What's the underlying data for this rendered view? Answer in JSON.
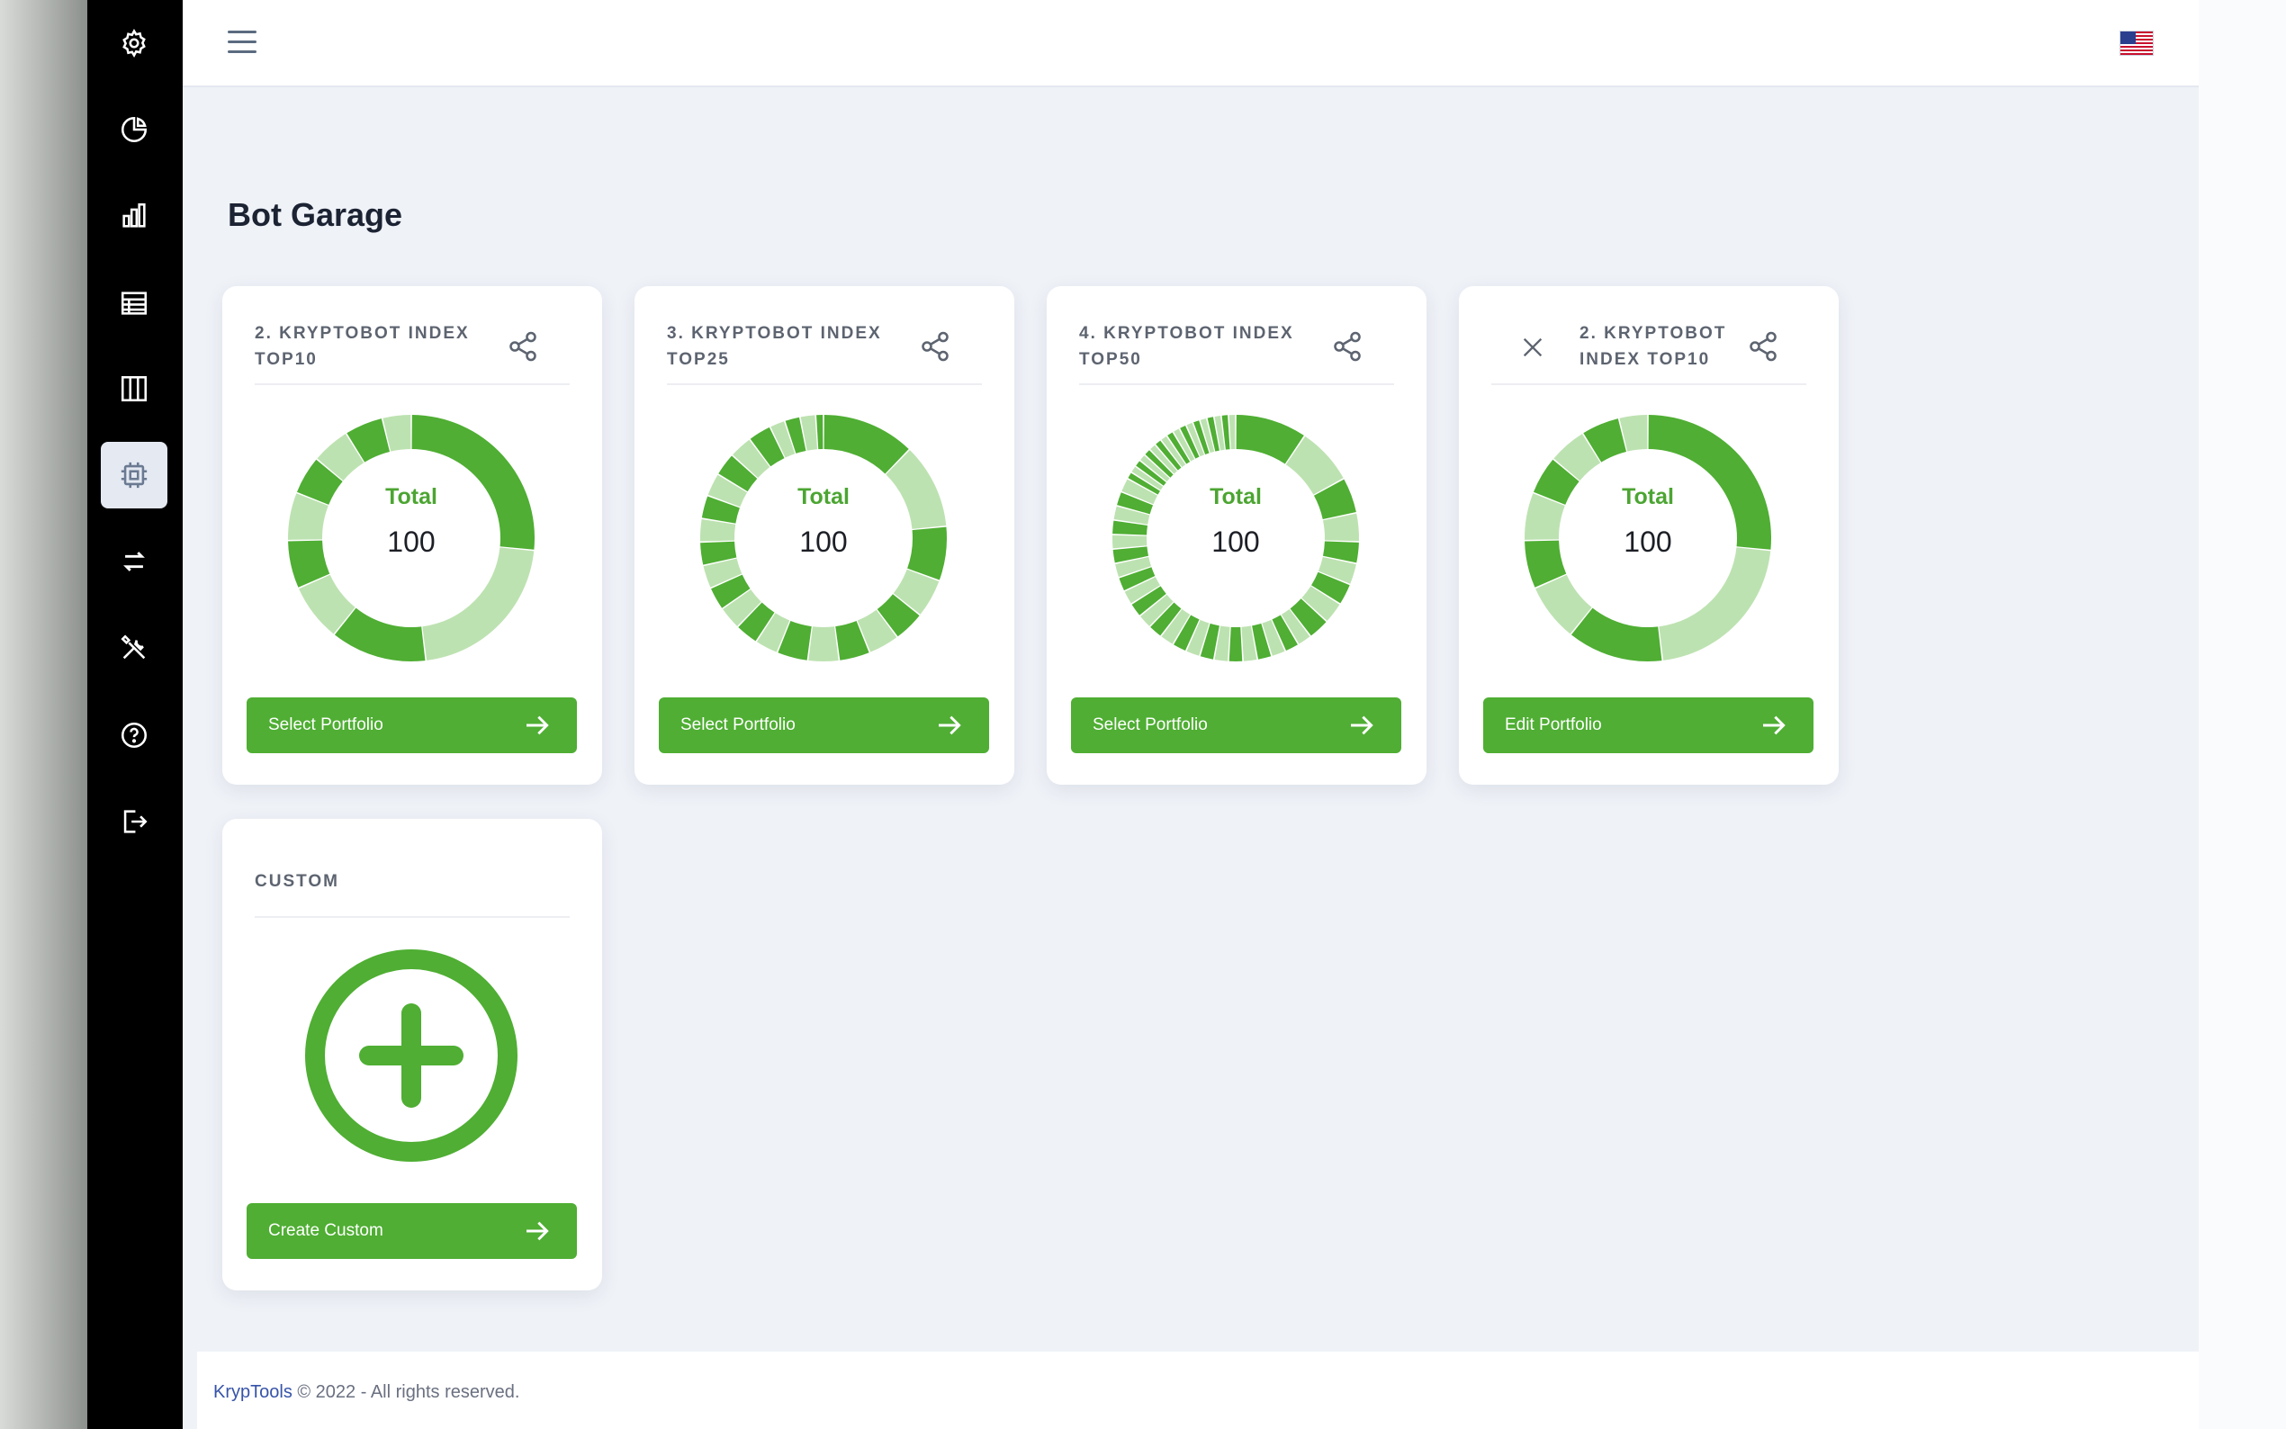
{
  "topbar": {
    "menu_icon": "hamburger-menu-icon",
    "language_icon": "us-flag-icon"
  },
  "sidebar": {
    "items": [
      {
        "icon": "gear-icon",
        "active": false
      },
      {
        "icon": "pie-chart-icon",
        "active": false
      },
      {
        "icon": "bar-chart-icon",
        "active": false
      },
      {
        "icon": "table-icon",
        "active": false
      },
      {
        "icon": "columns-icon",
        "active": false
      },
      {
        "icon": "cpu-chip-icon",
        "active": true
      },
      {
        "icon": "transfer-arrows-icon",
        "active": false
      },
      {
        "icon": "tools-icon",
        "active": false
      },
      {
        "icon": "help-icon",
        "active": false
      },
      {
        "icon": "logout-icon",
        "active": false
      }
    ]
  },
  "page": {
    "title": "Bot Garage"
  },
  "colors": {
    "accent_green": "#4fae33",
    "dark_segment": "#4fae33",
    "light_segment": "#bde2b1",
    "sidebar_bg": "#000000"
  },
  "cards": [
    {
      "title": "2. KRYPTOBOT INDEX TOP10",
      "total_label": "Total",
      "total_value": "100",
      "button_label": "Select Portfolio",
      "has_close": false,
      "allocation": [
        21,
        17,
        10,
        6,
        5,
        5,
        4,
        4,
        4,
        3
      ]
    },
    {
      "title": "3. KRYPTOBOT INDEX TOP25",
      "total_label": "Total",
      "total_value": "100",
      "button_label": "Select Portfolio",
      "has_close": false,
      "allocation": [
        12,
        11,
        7,
        5,
        4,
        4,
        4,
        4,
        4,
        3,
        3,
        3,
        3,
        3,
        3,
        3,
        3,
        3,
        3,
        3,
        3,
        2,
        2,
        2,
        1
      ]
    },
    {
      "title": "4. KRYPTOBOT INDEX TOP50",
      "total_label": "Total",
      "total_value": "100",
      "button_label": "Select Portfolio",
      "has_close": false,
      "allocation": [
        10,
        8,
        5,
        4,
        3,
        3,
        3,
        3,
        3,
        2,
        2,
        2,
        2,
        2,
        2,
        2,
        2,
        2,
        2,
        2,
        2,
        2,
        2,
        2,
        2,
        2,
        2,
        2,
        2,
        2,
        2,
        2,
        1,
        1,
        1,
        1,
        1,
        1,
        1,
        1,
        1,
        1,
        1,
        1,
        1,
        1,
        1,
        1,
        1,
        1
      ]
    },
    {
      "title": "2. KRYPTOBOT INDEX TOP10",
      "total_label": "Total",
      "total_value": "100",
      "button_label": "Edit Portfolio",
      "has_close": true,
      "allocation": [
        21,
        17,
        10,
        6,
        5,
        5,
        4,
        4,
        4,
        3
      ]
    }
  ],
  "custom_card": {
    "title": "CUSTOM",
    "button_label": "Create Custom",
    "icon": "plus-circle-icon"
  },
  "footer": {
    "brand": "KrypTools",
    "text": "© 2022 - All rights reserved."
  }
}
